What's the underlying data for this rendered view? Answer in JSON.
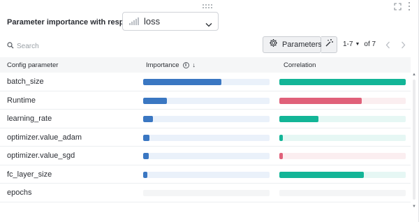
{
  "header": {
    "label": "Parameter importance with respect to",
    "metric": "loss"
  },
  "search": {
    "placeholder": "Search",
    "value": ""
  },
  "toolbar": {
    "parameters_label": "Parameters"
  },
  "pagination": {
    "range": "1-7",
    "of_label": "of 7"
  },
  "table": {
    "columns": [
      "Config parameter",
      "Importance",
      "Correlation"
    ],
    "rows": [
      {
        "name": "batch_size",
        "importance": 0.62,
        "correlation": 1.0,
        "sign": "pos"
      },
      {
        "name": "Runtime",
        "importance": 0.19,
        "correlation": 0.65,
        "sign": "neg"
      },
      {
        "name": "learning_rate",
        "importance": 0.08,
        "correlation": 0.31,
        "sign": "pos"
      },
      {
        "name": "optimizer.value_adam",
        "importance": 0.05,
        "correlation": 0.03,
        "sign": "pos"
      },
      {
        "name": "optimizer.value_sgd",
        "importance": 0.045,
        "correlation": 0.03,
        "sign": "neg"
      },
      {
        "name": "fc_layer_size",
        "importance": 0.035,
        "correlation": 0.67,
        "sign": "pos"
      },
      {
        "name": "epochs",
        "importance": null,
        "correlation": null,
        "sign": "none"
      }
    ]
  },
  "colors": {
    "importance": "#3a77c2",
    "correlation_positive": "#13b597",
    "correlation_negative": "#e0617a"
  },
  "icons": [
    "drag-handle-icon",
    "fullscreen-icon",
    "more-icon",
    "bar-chart-icon",
    "chevron-down-icon",
    "search-icon",
    "gear-icon",
    "magic-wand-icon",
    "info-icon",
    "sort-desc-icon",
    "chevron-left-icon",
    "chevron-right-icon"
  ]
}
